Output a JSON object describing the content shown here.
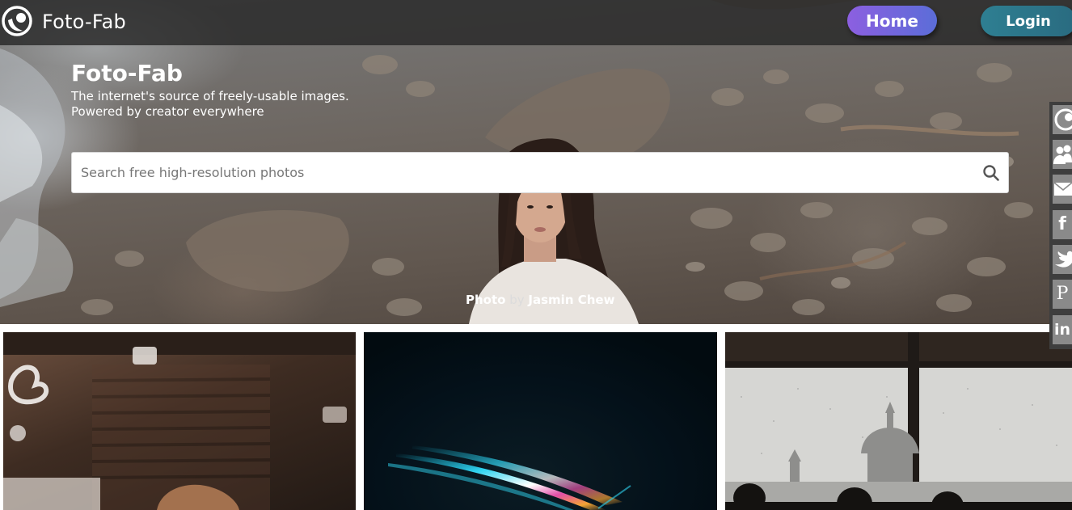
{
  "nav": {
    "brand": "Foto-Fab",
    "home_label": "Home",
    "login_label": "Login"
  },
  "hero": {
    "title": "Foto-Fab",
    "tagline_line1": "The internet's source of freely-usable images.",
    "tagline_line2": "Powered by creator everywhere",
    "search_placeholder": "Search free high-resolution photos",
    "credit_prefix": "Photo",
    "credit_by": "by",
    "credit_author": "Jasmin Chew"
  },
  "social": {
    "items": [
      {
        "name": "brand-logo",
        "icon": "logo-icon"
      },
      {
        "name": "community",
        "icon": "users-icon"
      },
      {
        "name": "email",
        "icon": "envelope-icon"
      },
      {
        "name": "facebook",
        "icon": "facebook-icon",
        "glyph": "f"
      },
      {
        "name": "twitter",
        "icon": "twitter-icon"
      },
      {
        "name": "pinterest",
        "icon": "pinterest-icon",
        "glyph": "P"
      },
      {
        "name": "linkedin",
        "icon": "linkedin-icon",
        "glyph": "in"
      }
    ]
  },
  "gallery": {
    "tiles": [
      {
        "name": "cafe-interior-photo"
      },
      {
        "name": "light-streak-photo"
      },
      {
        "name": "rainy-window-city-photo"
      }
    ]
  },
  "colors": {
    "home_gradient": [
      "#8c5fe0",
      "#5b6dd8"
    ],
    "login_gradient": [
      "#2e7f92",
      "#2a6b80"
    ],
    "navbar": "#262626",
    "social_bar": "#3e3e3e"
  }
}
